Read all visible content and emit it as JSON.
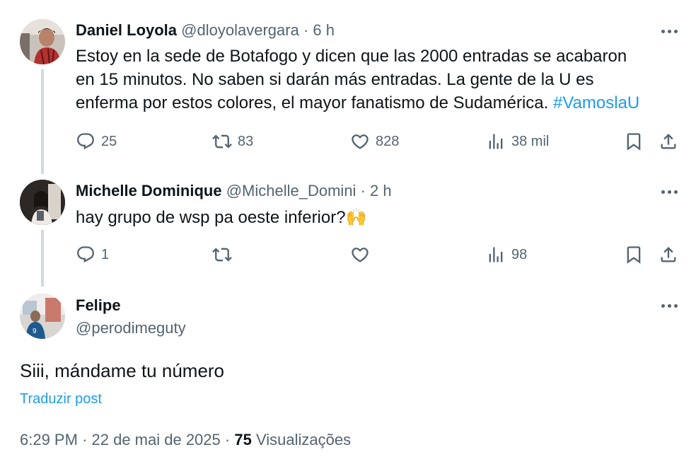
{
  "tweet1": {
    "name": "Daniel Loyola",
    "handle": "@dloyolavergara",
    "separator": "·",
    "time": "6 h",
    "text_line1": "Estoy en la sede de Botafogo y dicen que las 2000 entradas se acabaron",
    "text_line2": "en 15 minutos. No saben si darán más entradas. La gente de la U es",
    "text_line3": "enferma por estos colores,  el mayor fanatismo de Sudamérica.",
    "hashtag": "#VamoslaU",
    "replies": "25",
    "retweets": "83",
    "likes": "828",
    "views": "38 mil"
  },
  "tweet2": {
    "name": "Michelle Dominique",
    "handle": "@Michelle_Domini",
    "separator": "·",
    "time": "2 h",
    "text": "hay grupo de wsp pa oeste inferior?",
    "emoji": "🙌",
    "replies": "1",
    "retweets": "",
    "likes": "",
    "views": "98"
  },
  "main": {
    "name": "Felipe",
    "handle": "@perodimeguty",
    "text": "Siii, mándame tu número",
    "translate_label": "Traduzir post",
    "time": "6:29 PM",
    "separator": "·",
    "date": "22 de mai de 2025",
    "views_count": "75",
    "views_label": "Visualizações"
  },
  "icons": {
    "reply": "reply-icon",
    "retweet": "retweet-icon",
    "like": "like-icon",
    "views": "views-icon",
    "bookmark": "bookmark-icon",
    "share": "share-icon",
    "more": "more-icon"
  },
  "colors": {
    "text": "#0f1419",
    "secondary": "#536471",
    "accent": "#1d9bf0",
    "thread_line": "#cfd9de"
  }
}
